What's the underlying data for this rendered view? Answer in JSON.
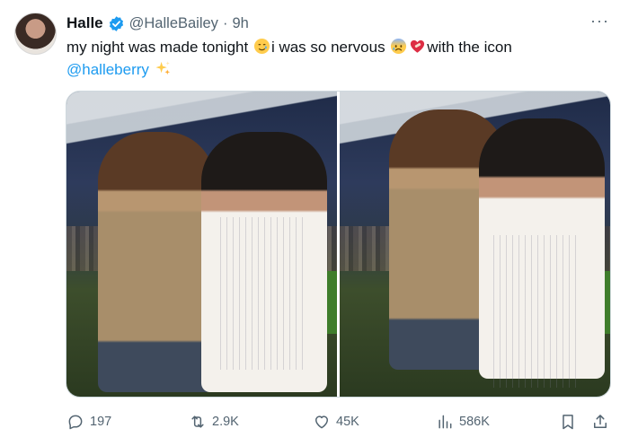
{
  "tweet": {
    "author_name": "Halle",
    "handle": "@HalleBailey",
    "separator": "·",
    "time": "9h",
    "text_part1": "my night was made tonight ",
    "text_part2": "i was so nervous ",
    "text_part3": "with the icon",
    "mention": "@halleberry",
    "more_label": "···"
  },
  "media": {
    "photos": [
      "photo-left",
      "photo-right"
    ]
  },
  "actions": {
    "replies": "197",
    "reposts": "2.9K",
    "likes": "45K",
    "views": "586K"
  },
  "colors": {
    "accent": "#1d9bf0",
    "muted": "#536471",
    "text": "#0f1419"
  },
  "icons": [
    "verified-icon",
    "smiling-face-with-tear-emoji",
    "anxious-face-emoji",
    "mending-heart-emoji",
    "sparkles-emoji",
    "reply-icon",
    "repost-icon",
    "like-icon",
    "views-icon",
    "bookmark-icon",
    "share-icon",
    "more-icon"
  ]
}
